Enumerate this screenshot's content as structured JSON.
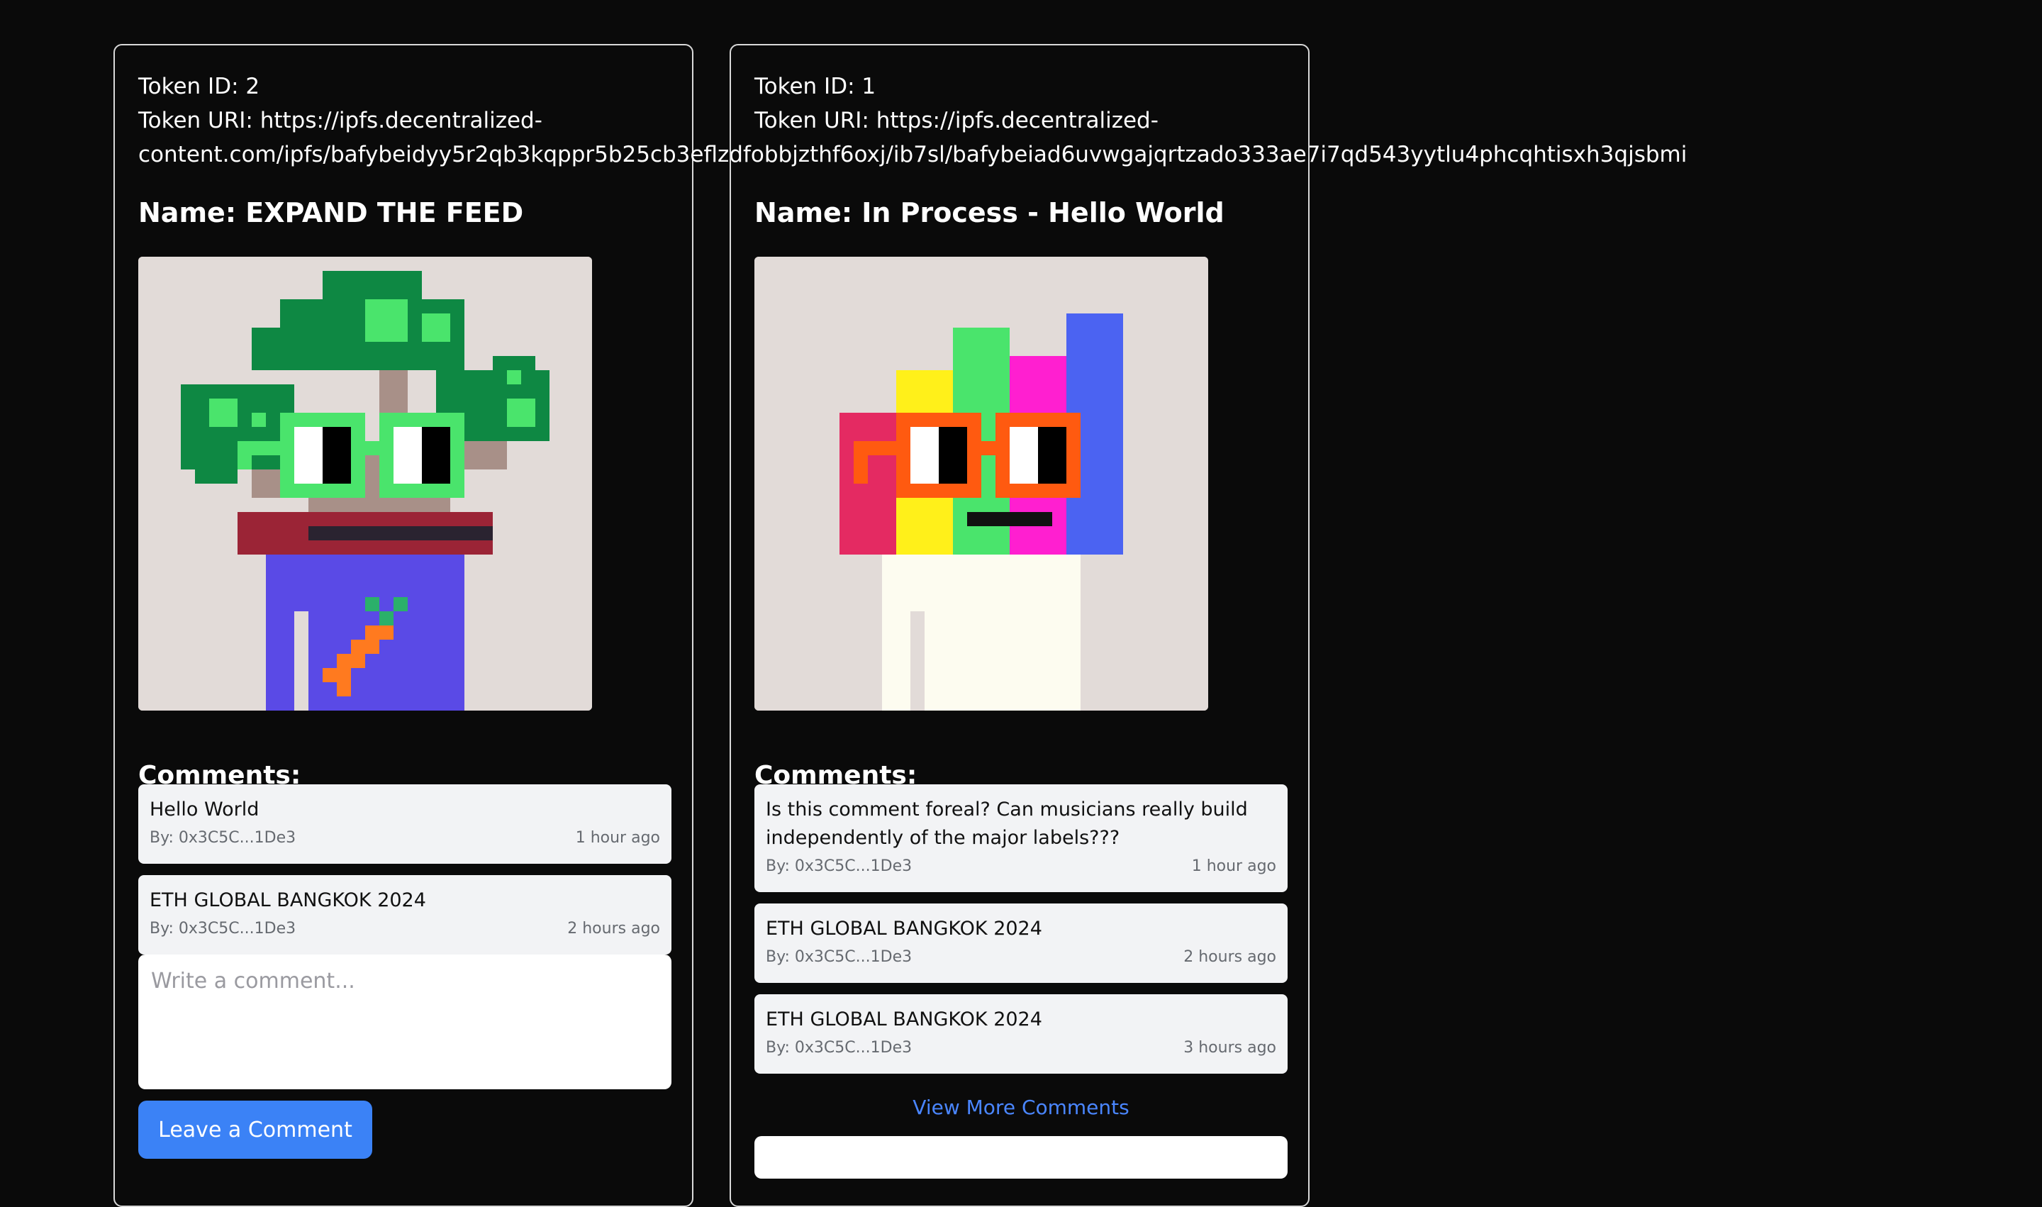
{
  "cards": [
    {
      "token_id": "Token ID: 2",
      "token_uri_line1": "Token URI: https://ipfs.decentralized-",
      "token_uri_line2": "content.com/ipfs/bafybeidyy5r2qb3kqppr5b25cb3eflzdfobbjzthf6oxj/ib7sl/bafybeiad6uvwgajqrtzado333ae7i7qd543yytlu4phcqhtisxh3qjsbmi",
      "name": "Name: EXPAND THE FEED",
      "comments_heading": "Comments:",
      "comments": [
        {
          "text": "Hello World",
          "author": "By: 0x3C5C...1De3",
          "time": "1 hour ago"
        },
        {
          "text": "ETH GLOBAL BANGKOK 2024",
          "author": "By: 0x3C5C...1De3",
          "time": "2 hours ago"
        }
      ],
      "input_placeholder": "Write a comment...",
      "button_label": "Leave a Comment"
    },
    {
      "token_id": "Token ID: 1",
      "token_uri_line1": "Token URI: https://ipfs.decentralized-",
      "name": "Name: In Process - Hello World",
      "comments_heading": "Comments:",
      "comments": [
        {
          "text": "Is this comment foreal? Can musicians really build independently of the major labels???",
          "author": "By: 0x3C5C...1De3",
          "time": "1 hour ago"
        },
        {
          "text": "ETH GLOBAL BANGKOK 2024",
          "author": "By: 0x3C5C...1De3",
          "time": "2 hours ago"
        },
        {
          "text": "ETH GLOBAL BANGKOK 2024",
          "author": "By: 0x3C5C...1De3",
          "time": "3 hours ago"
        }
      ],
      "view_more_label": "View More Comments"
    }
  ],
  "colors": {
    "background": "#0a0a0a",
    "card_border": "#d9d9d9",
    "comment_bg": "#f2f3f5",
    "button": "#3b82f6",
    "link": "#4a86ff"
  }
}
